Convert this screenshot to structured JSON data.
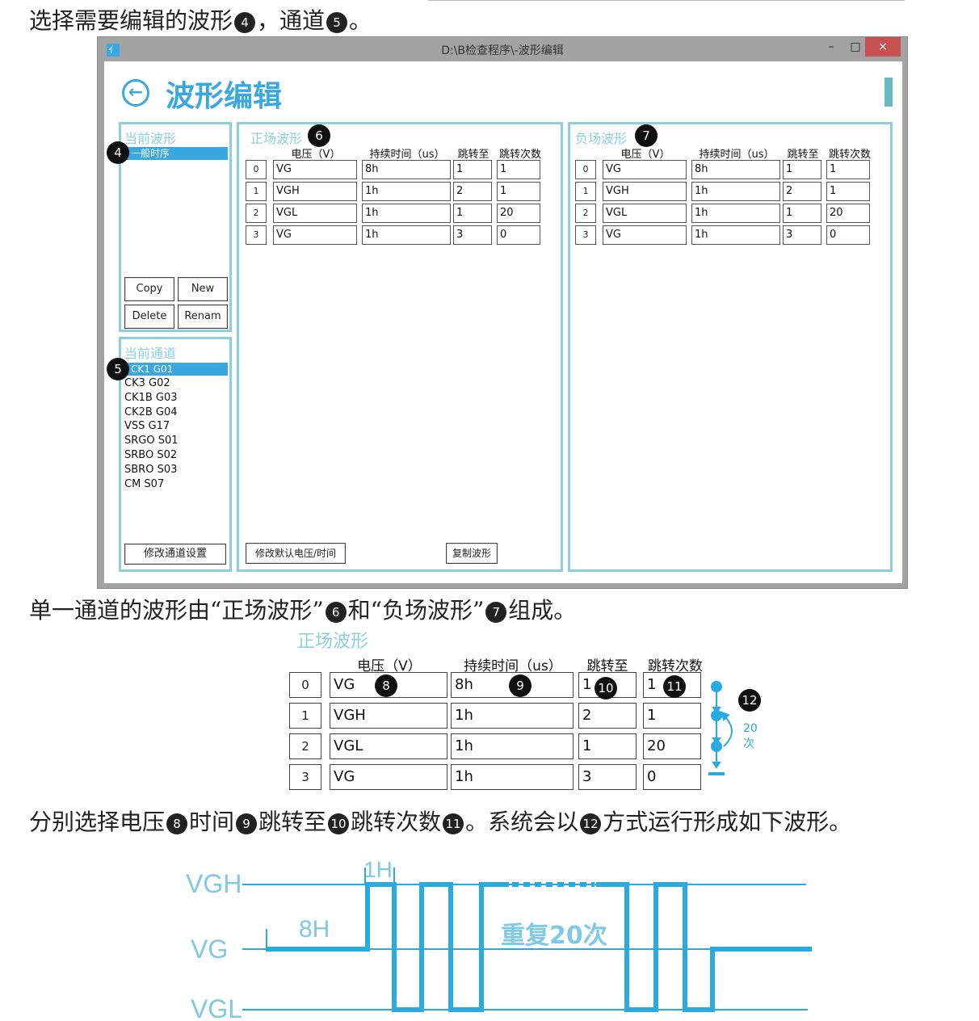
{
  "doc": {
    "line1_a": "选择需要编辑的波形",
    "line1_n1": "4",
    "line1_b": "，通道",
    "line1_n2": "5",
    "line1_c": "。",
    "line2_a": "单一通道的波形由“正场波形”",
    "line2_n1": "6",
    "line2_b": "和“负场波形”",
    "line2_n2": "7",
    "line2_c": "组成。",
    "line3_a": "分别选择电压",
    "line3_n1": "8",
    "line3_b": "时间",
    "line3_n2": "9",
    "line3_c": "跳转至",
    "line3_n3": "10",
    "line3_d": "跳转次数",
    "line3_n4": "11",
    "line3_e": "。系统会以",
    "line3_n5": "12",
    "line3_f": "方式运行形成如下波形。"
  },
  "window": {
    "title": "D:\\B检查程序\\-波形编辑",
    "minimize": "–",
    "maximize": "□",
    "close": "×",
    "page_title": "波形编辑",
    "back_icon": "arrow-left-icon"
  },
  "current_wave": {
    "label": "当前波形",
    "badge": "4",
    "items": [
      "一般时序"
    ],
    "buttons": {
      "copy": "Copy",
      "new": "New",
      "delete": "Delete",
      "rename": "Renam"
    }
  },
  "current_channel": {
    "label": "当前通道",
    "badge": "5",
    "selected": "CK1 G01",
    "items": [
      "CK3 G02",
      "CK1B G03",
      "CK2B G04",
      "VSS G17",
      "SRGO S01",
      "SRBO S02",
      "SBRO S03",
      "CM S07"
    ],
    "modify_button": "修改通道设置"
  },
  "table_headers": {
    "voltage": "电压（V）",
    "duration": "持续时间（us）",
    "jump_to": "跳转至",
    "jump_count": "跳转次数"
  },
  "positive": {
    "label": "正场波形",
    "badge": "6",
    "rows": [
      {
        "i": "0",
        "v": "VG",
        "t": "8h",
        "j": "1",
        "c": "1"
      },
      {
        "i": "1",
        "v": "VGH",
        "t": "1h",
        "j": "2",
        "c": "1"
      },
      {
        "i": "2",
        "v": "VGL",
        "t": "1h",
        "j": "1",
        "c": "20"
      },
      {
        "i": "3",
        "v": "VG",
        "t": "1h",
        "j": "3",
        "c": "0"
      }
    ],
    "default_button": "修改默认电压/时间",
    "copy_button": "复制波形"
  },
  "negative": {
    "label": "负场波形",
    "badge": "7",
    "rows": [
      {
        "i": "0",
        "v": "VG",
        "t": "8h",
        "j": "1",
        "c": "1"
      },
      {
        "i": "1",
        "v": "VGH",
        "t": "1h",
        "j": "2",
        "c": "1"
      },
      {
        "i": "2",
        "v": "VGL",
        "t": "1h",
        "j": "1",
        "c": "20"
      },
      {
        "i": "3",
        "v": "VG",
        "t": "1h",
        "j": "3",
        "c": "0"
      }
    ]
  },
  "zoom": {
    "label": "正场波形",
    "badges": {
      "voltage": "8",
      "time": "9",
      "jump": "10",
      "count": "11",
      "loop": "12"
    },
    "loop_text": "20次"
  },
  "waveform": {
    "levels": [
      "VGH",
      "VG",
      "VGL"
    ],
    "label_8h": "8H",
    "label_1h": "1H",
    "repeat_text": "重复20次",
    "color": "#29abe2"
  }
}
